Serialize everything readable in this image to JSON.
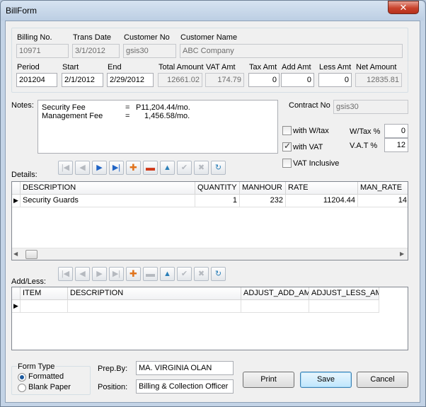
{
  "window": {
    "title": "BillForm",
    "close_glyph": "✕"
  },
  "header": {
    "billing_no": {
      "label": "Billing No.",
      "value": "10971"
    },
    "trans_date": {
      "label": "Trans Date",
      "value": "3/1/2012"
    },
    "customer_no": {
      "label": "Customer No",
      "value": "gsis30"
    },
    "customer_name": {
      "label": "Customer Name",
      "value": "ABC Company"
    },
    "period": {
      "label": "Period",
      "value": "201204"
    },
    "start": {
      "label": "Start",
      "value": "2/1/2012"
    },
    "end": {
      "label": "End",
      "value": "2/29/2012"
    },
    "total_amount": {
      "label": "Total Amount",
      "value": "12661.02"
    },
    "vat_amt": {
      "label": "VAT Amt",
      "value": "174.79"
    },
    "tax_amt": {
      "label": "Tax Amt",
      "value": "0"
    },
    "add_amt": {
      "label": "Add Amt",
      "value": "0"
    },
    "less_amt": {
      "label": "Less Amt",
      "value": "0"
    },
    "net_amount": {
      "label": "Net Amount",
      "value": "12835.81"
    }
  },
  "notes": {
    "label": "Notes:",
    "lines": [
      {
        "name": "Security Fee",
        "eq": "=",
        "amount": "P11,204.44/mo."
      },
      {
        "name": "Management Fee",
        "eq": "=",
        "amount": "1,456.58/mo."
      }
    ]
  },
  "contract": {
    "label": "Contract No",
    "value": "gsis30"
  },
  "options": {
    "with_wtax": {
      "label": "with W/tax",
      "checked": false
    },
    "with_vat": {
      "label": "with VAT",
      "checked": true
    },
    "vat_inclusive": {
      "label": "VAT Inclusive",
      "checked": false
    },
    "wtax_pct": {
      "label": "W/Tax %",
      "value": "0"
    },
    "vat_pct": {
      "label": "V.A.T %",
      "value": "12"
    }
  },
  "details": {
    "label": "Details:",
    "columns": [
      "DESCRIPTION",
      "QUANTITY",
      "MANHOUR",
      "RATE",
      "MAN_RATE"
    ],
    "rows": [
      [
        "Security Guards",
        "1",
        "232",
        "11204.44",
        "14"
      ]
    ]
  },
  "addless": {
    "label": "Add/Less:",
    "columns": [
      "ITEM",
      "DESCRIPTION",
      "ADJUST_ADD_AMT",
      "ADJUST_LESS_AMT"
    ]
  },
  "form_type": {
    "label": "Form Type",
    "options": [
      "Formatted",
      "Blank Paper"
    ],
    "selected": "Formatted"
  },
  "prep_by": {
    "label": "Prep.By:",
    "value": "MA. VIRGINIA OLAN"
  },
  "position": {
    "label": "Position:",
    "value": "Billing & Collection Officer"
  },
  "buttons": {
    "print": "Print",
    "save": "Save",
    "cancel": "Cancel"
  },
  "colors": {
    "accent": "#3c7fb1",
    "add_orange": "#e0731c",
    "delete_red": "#d03a1a"
  }
}
